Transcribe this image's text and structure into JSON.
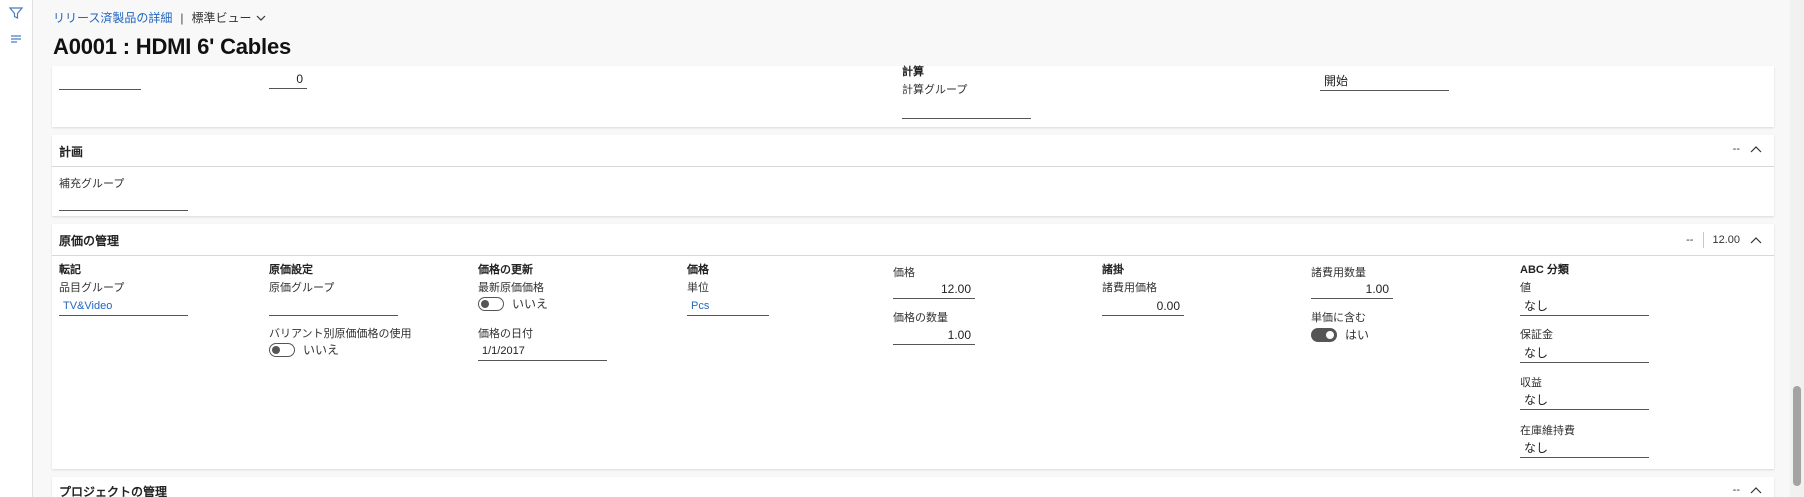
{
  "nav": {
    "breadcrumb_link": "リリース済製品の詳細",
    "separator": "|",
    "view_label": "標準ビュー"
  },
  "page_title": "A0001 : HDMI 6' Cables",
  "top_section": {
    "value_zero": "0",
    "calc_group_heading": "計算",
    "calc_group_label": "計算グループ",
    "start_value": "開始"
  },
  "planning": {
    "title": "計画",
    "summary": "--",
    "replenishment_label": "補充グループ"
  },
  "cost": {
    "title": "原価の管理",
    "summary_dash": "--",
    "summary_value": "12.00",
    "posting": {
      "heading": "転記",
      "item_group_label": "品目グループ",
      "item_group_value": "TV&Video"
    },
    "cost_setup": {
      "heading": "原価設定",
      "cost_group_label": "原価グループ",
      "variant_label": "バリアント別原価価格の使用",
      "variant_value": "いいえ"
    },
    "price_update": {
      "heading": "価格の更新",
      "latest_cost_label": "最新原価価格",
      "latest_cost_value": "いいえ",
      "price_date_label": "価格の日付",
      "price_date_value": "1/1/2017"
    },
    "price": {
      "heading": "価格",
      "unit_label": "単位",
      "unit_value": "Pcs"
    },
    "price_values": {
      "price_label": "価格",
      "price_value": "12.00",
      "qty_label": "価格の数量",
      "qty_value": "1.00"
    },
    "charges": {
      "heading": "諸掛",
      "charges_price_label": "諸費用価格",
      "charges_price_value": "0.00"
    },
    "charges_qty": {
      "qty_label": "諸費用数量",
      "qty_value": "1.00",
      "include_label": "単価に含む",
      "include_value": "はい"
    },
    "abc": {
      "heading": "ABC 分類",
      "value_label": "値",
      "value_value": "なし",
      "deposit_label": "保証金",
      "deposit_value": "なし",
      "revenue_label": "収益",
      "revenue_value": "なし",
      "carrying_label": "在庫維持費",
      "carrying_value": "なし"
    }
  },
  "project": {
    "title": "プロジェクトの管理",
    "summary": "--"
  },
  "colors": {
    "link": "#2266c0",
    "accent": "#4a7cc4"
  }
}
